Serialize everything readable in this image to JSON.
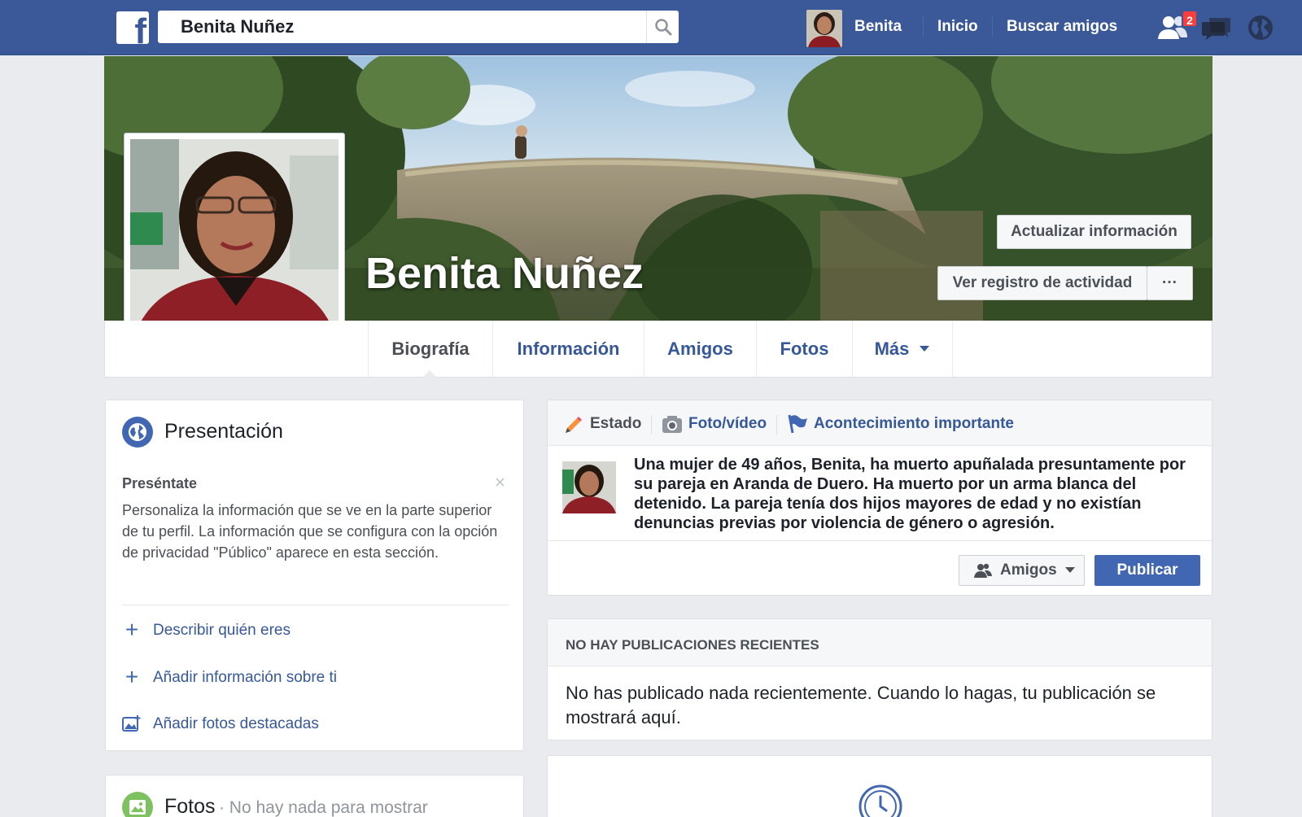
{
  "topbar": {
    "search_value": "Benita Nuñez",
    "user_name": "Benita",
    "nav_home": "Inicio",
    "nav_find_friends": "Buscar amigos",
    "friend_requests_badge": "2",
    "brand_color": "#3b5998"
  },
  "cover": {
    "profile_name": "Benita Nuñez",
    "update_info": "Actualizar información",
    "activity_log": "Ver registro de actividad",
    "more_dots": "···"
  },
  "tabs": {
    "timeline": "Biografía",
    "about": "Información",
    "friends": "Amigos",
    "photos": "Fotos",
    "more": "Más"
  },
  "intro": {
    "title": "Presentación",
    "subtitle": "Preséntate",
    "description": "Personaliza la información que se ve en la parte superior de tu perfil. La información que se configura con la opción de privacidad \"Público\" aparece en esta sección.",
    "close": "×",
    "link_describe": "Describir quién eres",
    "link_add_info": "Añadir información sobre ti",
    "link_featured": "Añadir fotos destacadas"
  },
  "photos_card": {
    "title": "Fotos",
    "subtitle": "· No hay nada para mostrar"
  },
  "composer": {
    "tab_status": "Estado",
    "tab_photo": "Foto/vídeo",
    "tab_event": "Acontecimiento importante",
    "text": "Una mujer de 49 años, Benita, ha muerto apuñalada presuntamente por su pareja en Aranda de Duero. Ha muerto por  un arma blanca del detenido. La pareja tenía dos hijos mayores de edad y no existían denuncias previas por violencia de género o agresión.",
    "audience": "Amigos",
    "publish": "Publicar"
  },
  "recent": {
    "header": "NO HAY PUBLICACIONES RECIENTES",
    "body": "No has publicado nada recientemente. Cuando lo hagas, tu publicación se mostrará aquí."
  }
}
